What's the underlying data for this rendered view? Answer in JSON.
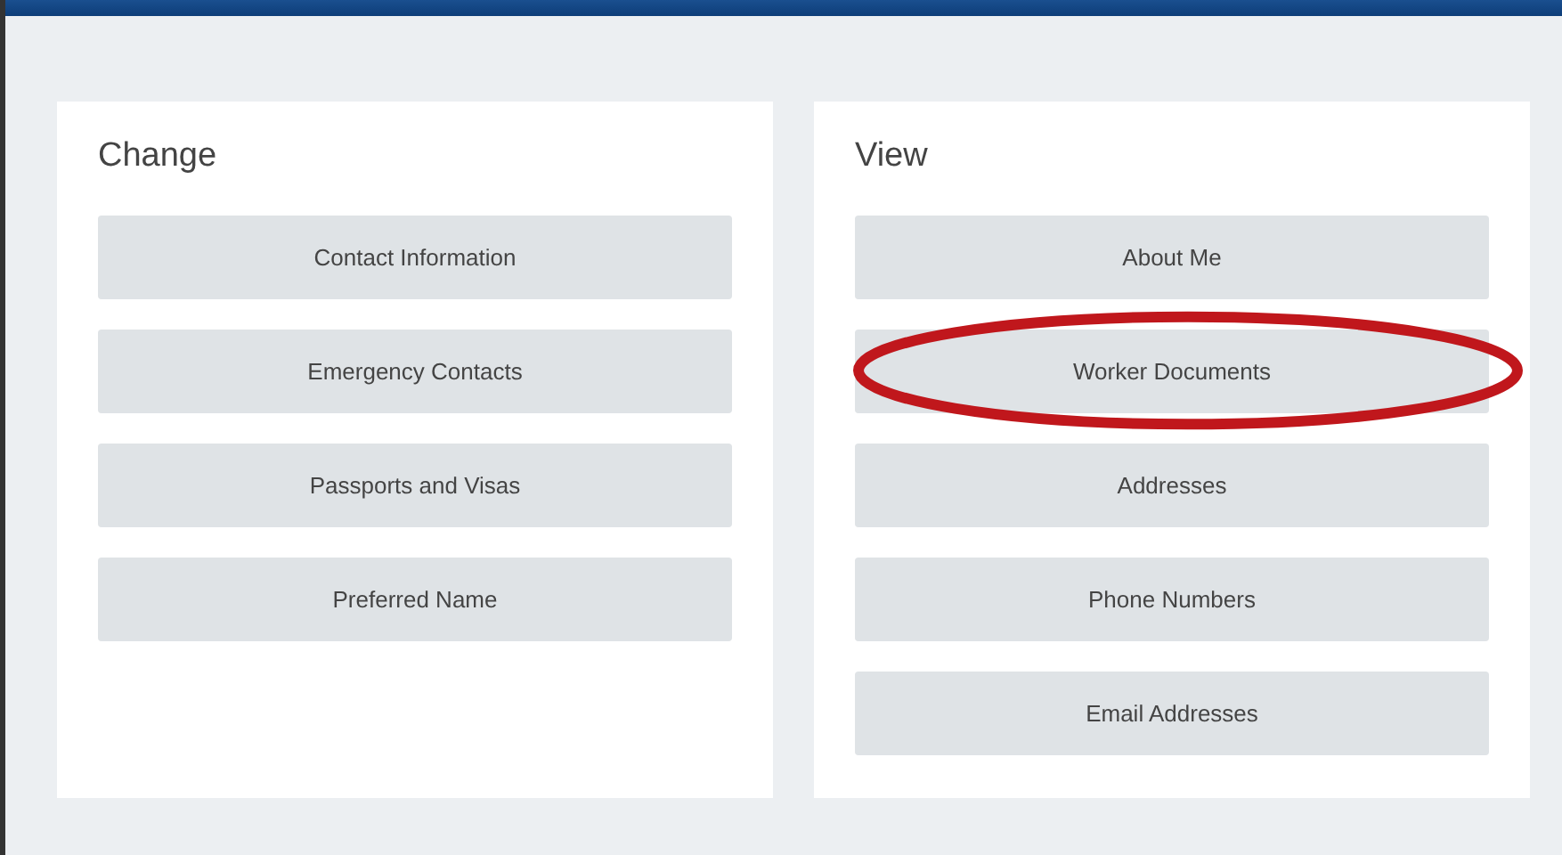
{
  "panels": [
    {
      "title": "Change",
      "items": [
        {
          "label": "Contact Information",
          "circled": false
        },
        {
          "label": "Emergency Contacts",
          "circled": false
        },
        {
          "label": "Passports and Visas",
          "circled": false
        },
        {
          "label": "Preferred Name",
          "circled": false
        }
      ]
    },
    {
      "title": "View",
      "items": [
        {
          "label": "About Me",
          "circled": false
        },
        {
          "label": "Worker Documents",
          "circled": true
        },
        {
          "label": "Addresses",
          "circled": false
        },
        {
          "label": "Phone Numbers",
          "circled": false
        },
        {
          "label": "Email Addresses",
          "circled": false
        }
      ]
    }
  ]
}
